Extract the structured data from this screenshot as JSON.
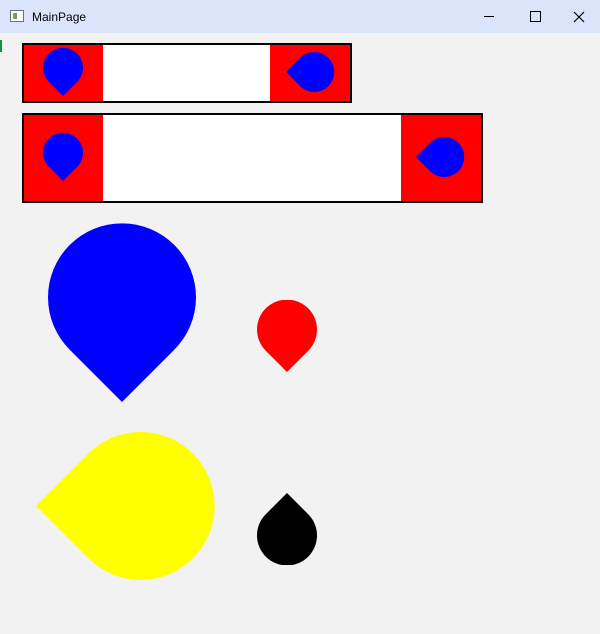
{
  "window": {
    "title": "MainPage",
    "controls": [
      "minimize",
      "maximize",
      "close"
    ]
  },
  "colors": {
    "titlebar": "#dae5fb",
    "background": "#f3f2f3",
    "bar_side": "#ff0000",
    "bar_fill": "#ffffff",
    "drop_blue": "#0000ff",
    "drop_red": "#ff0000",
    "drop_yellow": "#ffff00",
    "drop_black": "#000000"
  },
  "icons": {
    "app": "app-window-icon",
    "minimize": "minimize-icon",
    "maximize": "maximize-icon",
    "close": "close-icon"
  },
  "shapes": [
    "drop-point-down-blue",
    "drop-point-left-blue",
    "drop-point-down-red",
    "drop-point-left-yellow",
    "drop-point-up-black"
  ]
}
